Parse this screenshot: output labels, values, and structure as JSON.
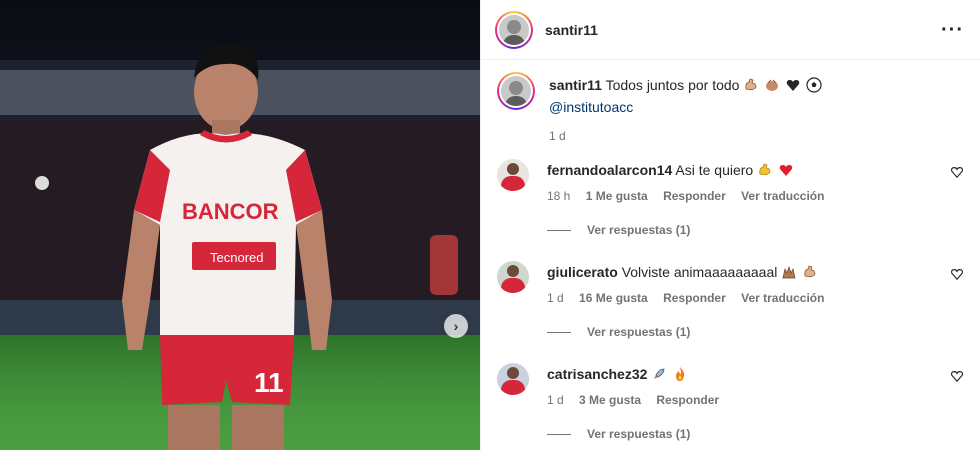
{
  "post": {
    "media": {
      "carousel_next_icon": "chevron-right-icon"
    },
    "header": {
      "username": "santir11",
      "more_icon": "more-horizontal-icon"
    },
    "caption": {
      "username": "santir11",
      "text": "Todos juntos por todo",
      "emojis": [
        "flexed-biceps",
        "clapping-hands",
        "heart",
        "soccer-ball"
      ],
      "mention": "@institutoacc",
      "time": "1 d"
    },
    "comments": [
      {
        "username": "fernandoalarcon14",
        "text": "Asi te quiero",
        "emojis": [
          "flexed-biceps",
          "red-heart"
        ],
        "time": "18 h",
        "likes": "1 Me gusta",
        "reply": "Responder",
        "translate": "Ver traducción",
        "view_replies": "Ver respuestas (1)"
      },
      {
        "username": "giulicerato",
        "text": "Volviste animaaaaaaaaal",
        "emojis": [
          "raising-hands",
          "flexed-biceps"
        ],
        "time": "1 d",
        "likes": "16 Me gusta",
        "reply": "Responder",
        "translate": "Ver traducción",
        "view_replies": "Ver respuestas (1)"
      },
      {
        "username": "catrisanchez32",
        "text": "",
        "emojis": [
          "rocket",
          "fire"
        ],
        "time": "1 d",
        "likes": "3 Me gusta",
        "reply": "Responder",
        "translate": "",
        "view_replies": "Ver respuestas (1)"
      }
    ]
  },
  "colors": {
    "mention": "#00376b",
    "secondary_text": "#737373",
    "jersey_red": "#d6263a"
  }
}
